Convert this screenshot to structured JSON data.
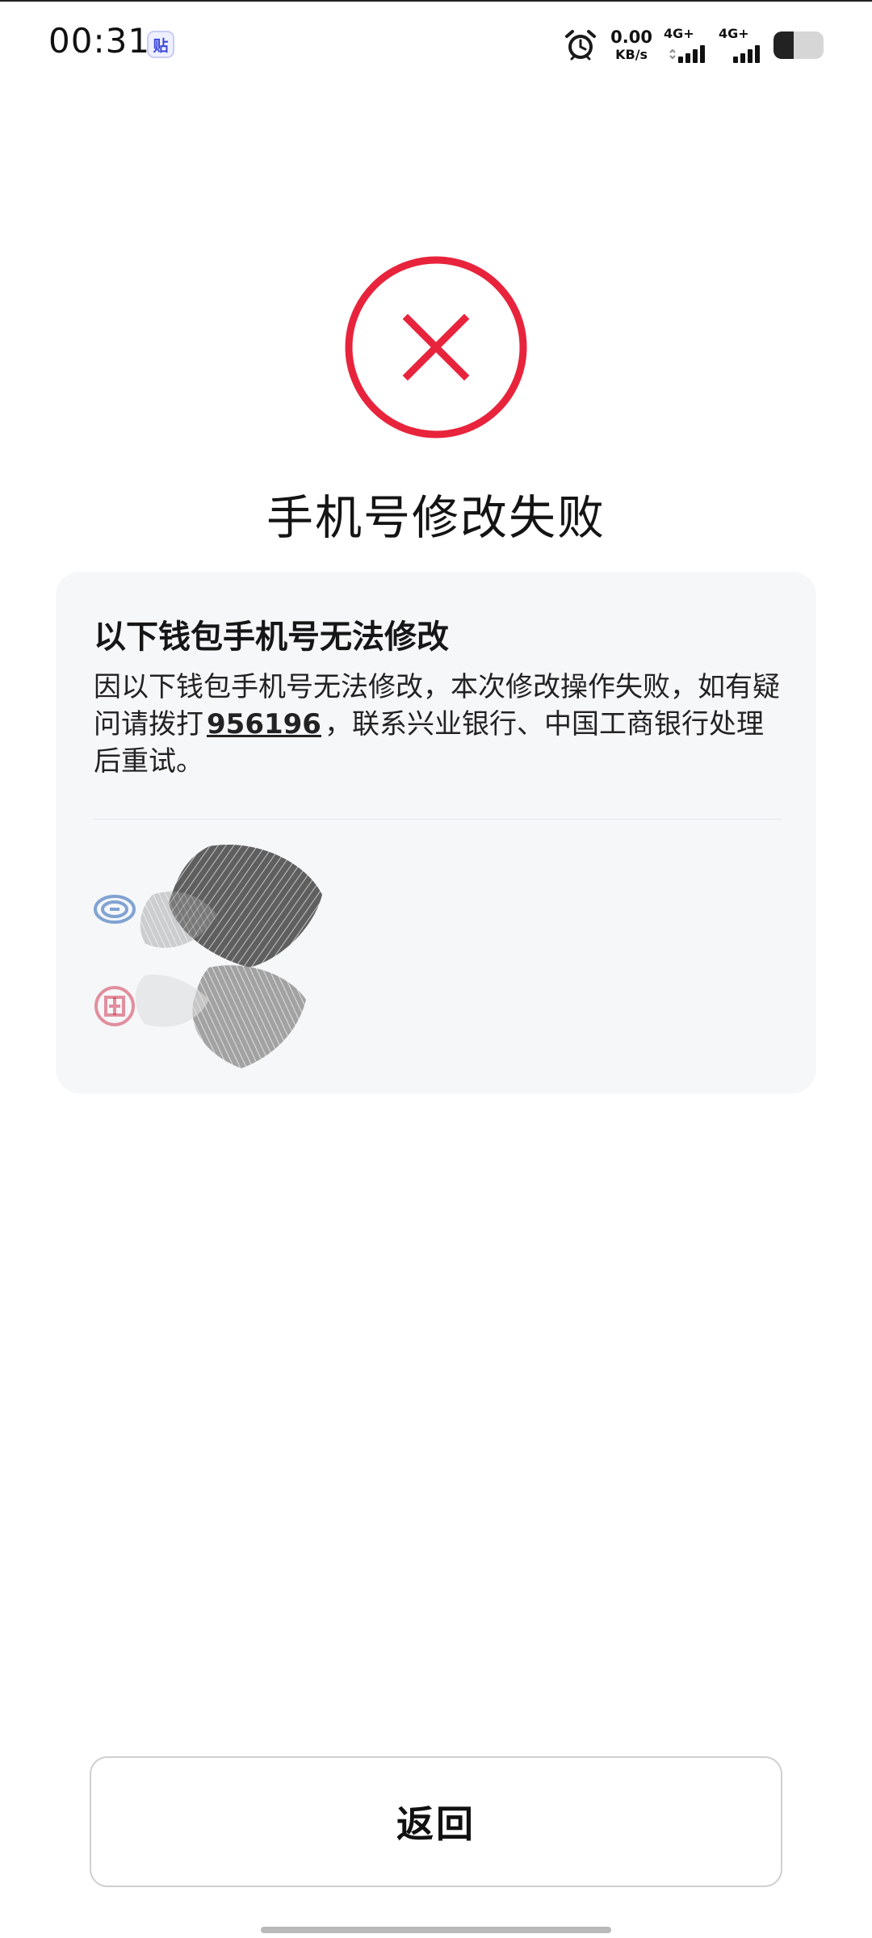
{
  "status_bar": {
    "time": "00:31",
    "app_badge": "贴",
    "net_speed_value": "0.00",
    "net_speed_unit": "KB/s",
    "sim1_label": "4G+",
    "sim2_label": "4G+",
    "battery_level_percent": 40,
    "icons": [
      "alarm-icon",
      "signal-icon",
      "battery-icon"
    ]
  },
  "result": {
    "icon": "error-x-icon",
    "status_color": "#e8243c",
    "title": "手机号修改失败"
  },
  "card": {
    "title": "以下钱包手机号无法修改",
    "desc_before": "因以下钱包手机号无法修改，本次修改操作失败，如有疑问请拨打",
    "phone": "956196",
    "desc_after": "，联系兴业银行、中国工商银行处理后重试。",
    "wallets": [
      {
        "name": "",
        "logo": "cib-bank-logo",
        "color": "#1f5fb2"
      },
      {
        "name": "",
        "logo": "icbc-bank-logo",
        "color": "#c8102e"
      }
    ]
  },
  "actions": {
    "back_label": "返回"
  }
}
